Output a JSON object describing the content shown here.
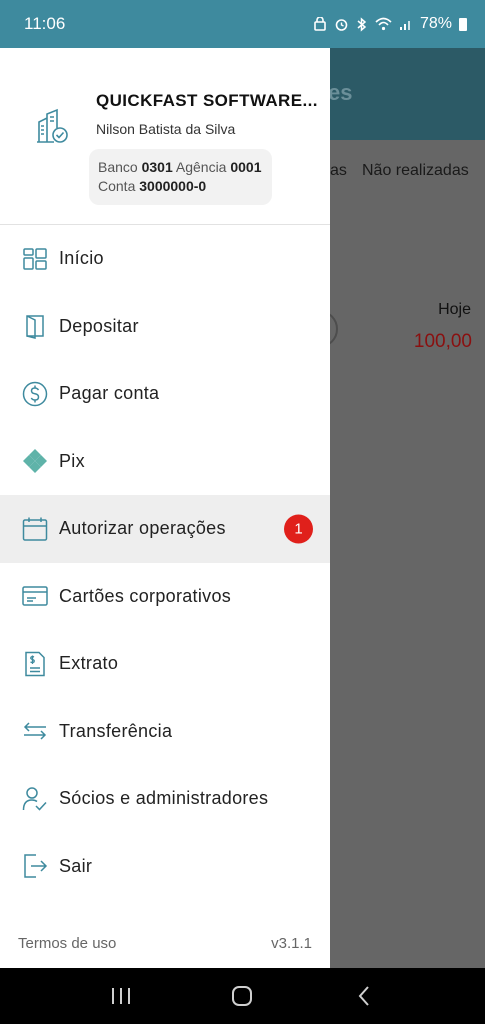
{
  "statusbar": {
    "time": "11:06",
    "battery": "78%"
  },
  "background": {
    "title": "es",
    "tab_partial": "as",
    "tab_not_done": "Não realizadas",
    "today_label": "Hoje",
    "today_amount": "100,00"
  },
  "drawer": {
    "company_name": "QUICKFAST SOFTWARE...",
    "user_name": "Nilson Batista da Silva",
    "bank_label": "Banco",
    "bank_value": "0301",
    "agency_label": "Agência",
    "agency_value": "0001",
    "account_label": "Conta",
    "account_value": "3000000-0",
    "menu": [
      {
        "label": "Início",
        "icon": "grid-icon"
      },
      {
        "label": "Depositar",
        "icon": "deposit-icon"
      },
      {
        "label": "Pagar conta",
        "icon": "dollar-circle-icon"
      },
      {
        "label": "Pix",
        "icon": "pix-icon"
      },
      {
        "label": "Autorizar operações",
        "icon": "calendar-icon",
        "badge": "1"
      },
      {
        "label": "Cartões corporativos",
        "icon": "card-icon"
      },
      {
        "label": "Extrato",
        "icon": "statement-icon"
      },
      {
        "label": "Transferência",
        "icon": "transfer-icon"
      },
      {
        "label": "Sócios e administradores",
        "icon": "partners-icon"
      },
      {
        "label": "Sair",
        "icon": "logout-icon"
      }
    ],
    "terms": "Termos de uso",
    "version": "v3.1.1"
  },
  "colors": {
    "accent": "#3e8a9e",
    "badge": "#e0201b",
    "amount": "#8a1010"
  }
}
